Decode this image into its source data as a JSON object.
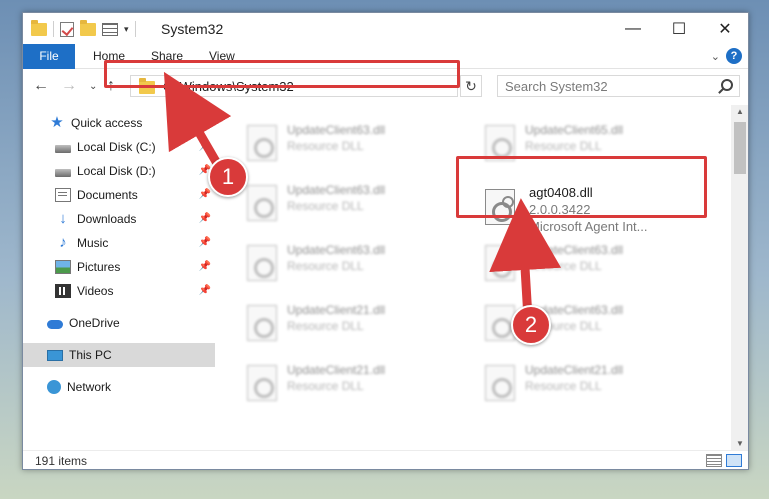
{
  "window": {
    "title": "System32",
    "controls": {
      "minimize": "—",
      "maximize": "☐",
      "close": "✕"
    }
  },
  "ribbon": {
    "tabs": [
      "File",
      "Home",
      "Share",
      "View"
    ],
    "expand": "⌄",
    "help": "?"
  },
  "nav": {
    "back": "←",
    "forward": "→",
    "recent": "⌄",
    "up": "↑",
    "address": "C:\\Windows\\System32",
    "refresh": "↻",
    "search_placeholder": "Search System32"
  },
  "sidebar": {
    "items": [
      {
        "label": "Quick access",
        "icon": "star-icon"
      },
      {
        "label": "Local Disk (C:)",
        "icon": "disk-icon",
        "pinned": true
      },
      {
        "label": "Local Disk (D:)",
        "icon": "disk-icon",
        "pinned": true
      },
      {
        "label": "Documents",
        "icon": "documents-icon",
        "pinned": true
      },
      {
        "label": "Downloads",
        "icon": "downloads-icon",
        "pinned": true
      },
      {
        "label": "Music",
        "icon": "music-icon",
        "pinned": true
      },
      {
        "label": "Pictures",
        "icon": "pictures-icon",
        "pinned": true
      },
      {
        "label": "Videos",
        "icon": "videos-icon",
        "pinned": true
      },
      {
        "label": "OneDrive",
        "icon": "cloud-icon"
      },
      {
        "label": "This PC",
        "icon": "computer-icon",
        "selected": true
      },
      {
        "label": "Network",
        "icon": "network-icon"
      }
    ]
  },
  "files": {
    "blurred": [
      {
        "name": "UpdateClient63.dll",
        "desc": "Resource DLL"
      },
      {
        "name": "UpdateClient65.dll",
        "desc": "Resource DLL"
      },
      {
        "name": "UpdateClient63.dll",
        "desc": "Resource DLL"
      },
      {
        "name": "UpdateClient63.dll",
        "desc": "Resource DLL"
      },
      {
        "name": "UpdateClient63.dll",
        "desc": "Resource DLL"
      },
      {
        "name": "UpdateClient21.dll",
        "desc": "Resource DLL"
      },
      {
        "name": "UpdateClient63.dll",
        "desc": "Resource DLL"
      },
      {
        "name": "UpdateClient21.dll",
        "desc": "Resource DLL"
      },
      {
        "name": "UpdateClient21.dll",
        "desc": "Resource DLL"
      }
    ],
    "highlighted": {
      "name": "agt0408.dll",
      "version": "2.0.0.3422",
      "desc": "Microsoft Agent Int..."
    }
  },
  "status": {
    "count": "191 items"
  },
  "annotations": {
    "step1": "1",
    "step2": "2",
    "color": "#d93a3a"
  }
}
